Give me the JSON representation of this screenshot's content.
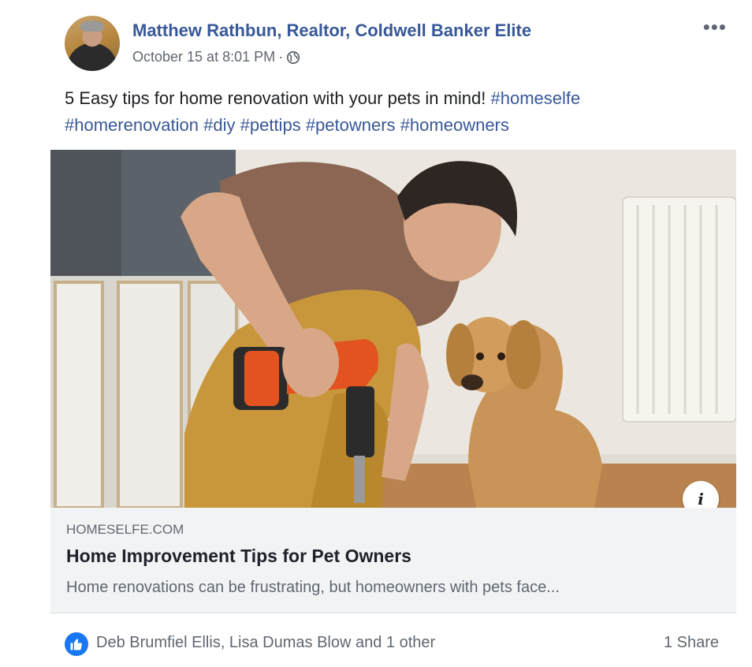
{
  "post": {
    "author": "Matthew Rathbun, Realtor, Coldwell Banker Elite",
    "timestamp": "October 15 at 8:01 PM",
    "separator": "·",
    "privacy_icon": "globe-icon",
    "more_options_icon": "more-options-icon",
    "text": "5 Easy tips for home renovation with your pets in mind!",
    "hashtags": [
      "#homeselfe",
      "#homerenovation",
      "#diy",
      "#pettips",
      "#petowners",
      "#homeowners"
    ]
  },
  "image": {
    "info_label": "i"
  },
  "link_preview": {
    "domain": "HOMESELFE.COM",
    "title": "Home Improvement Tips for Pet Owners",
    "description": "Home renovations can be frustrating, but homeowners with pets face..."
  },
  "footer": {
    "reaction_icon": "like-icon",
    "reactors": "Deb Brumfiel Ellis, Lisa Dumas Blow and 1 other",
    "shares": "1 Share"
  },
  "colors": {
    "link_blue": "#385898",
    "like_blue": "#1877f2",
    "meta_grey": "#606770",
    "preview_bg": "#f2f3f5"
  }
}
